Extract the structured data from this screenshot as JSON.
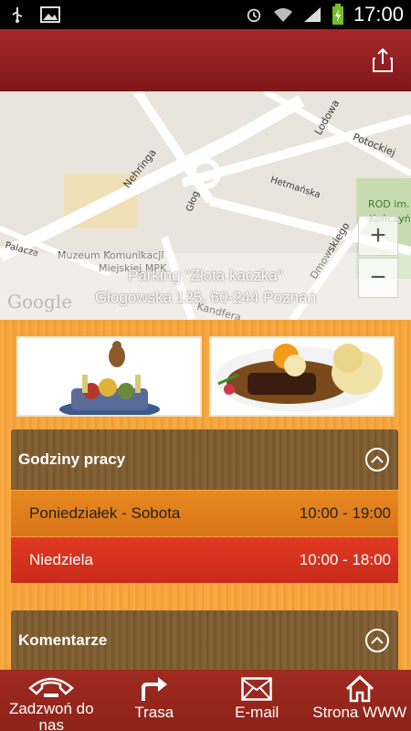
{
  "status_bar": {
    "time": "17:00",
    "icons": [
      "usb-icon",
      "image-icon",
      "alarm-icon",
      "wifi-icon",
      "signal-icon",
      "battery-charging-icon"
    ]
  },
  "header": {
    "share_icon": "share-icon"
  },
  "map": {
    "place_name": "Parking \"Złota kaczka\"",
    "address": "Głogowska 125, 60-244 Poznań",
    "logo": "Google",
    "zoom_in": "+",
    "zoom_out": "−",
    "labels": {
      "nehringa": "Nehringa",
      "lodowa": "Lodowa",
      "potockiej": "Potockiej",
      "hetmanska": "Hetmańska",
      "glog": "Głog",
      "rod": "ROD im.",
      "konczynska": "Kończyńsk",
      "dmowskiego": "Dmowskiego",
      "palacza": "Palacza",
      "muzeum1": "Muzeum Komunikacji",
      "muzeum2": "Miejskiej MPK",
      "kandfera": "Kandfera"
    }
  },
  "hours": {
    "title": "Godziny pracy",
    "rows": [
      {
        "day": "Poniedziałek - Sobota",
        "time": "10:00 - 19:00"
      },
      {
        "day": "Niedziela",
        "time": "10:00 - 18:00"
      }
    ]
  },
  "comments": {
    "title": "Komentarze"
  },
  "bottom_nav": [
    {
      "label": "Zadzwoń do nas",
      "icon": "phone-icon"
    },
    {
      "label": "Trasa",
      "icon": "route-arrow-icon"
    },
    {
      "label": "E-mail",
      "icon": "mail-icon"
    },
    {
      "label": "Strona WWW",
      "icon": "home-icon"
    }
  ],
  "colors": {
    "header": "#8f1c1e",
    "panel_header": "#7b5a2d",
    "weekday_row": "#e0801d",
    "sunday_row": "#d83220",
    "bottom_nav": "#962619",
    "background": "#f6a83c"
  }
}
